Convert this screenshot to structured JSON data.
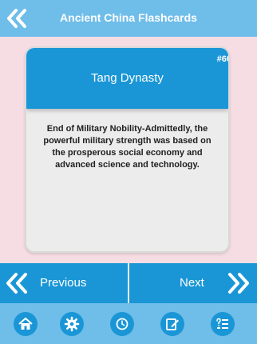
{
  "header": {
    "title": "Ancient China Flashcards"
  },
  "card": {
    "number": "#60",
    "title": "Tang Dynasty",
    "body": "End of Military Nobility-Admittedly, the powerful military strength was based on the prosperous social economy and advanced science and technology."
  },
  "nav": {
    "previous_label": "Previous",
    "next_label": "Next"
  },
  "bottom_tabs": [
    {
      "icon": "home-icon"
    },
    {
      "icon": "gear-icon"
    },
    {
      "icon": "timer-icon"
    },
    {
      "icon": "edit-note-icon"
    },
    {
      "icon": "quiz-list-icon"
    }
  ],
  "colors": {
    "bar": "#6fbde9",
    "accent": "#1a96d6",
    "background": "#f5dde3",
    "card": "#ececec"
  }
}
